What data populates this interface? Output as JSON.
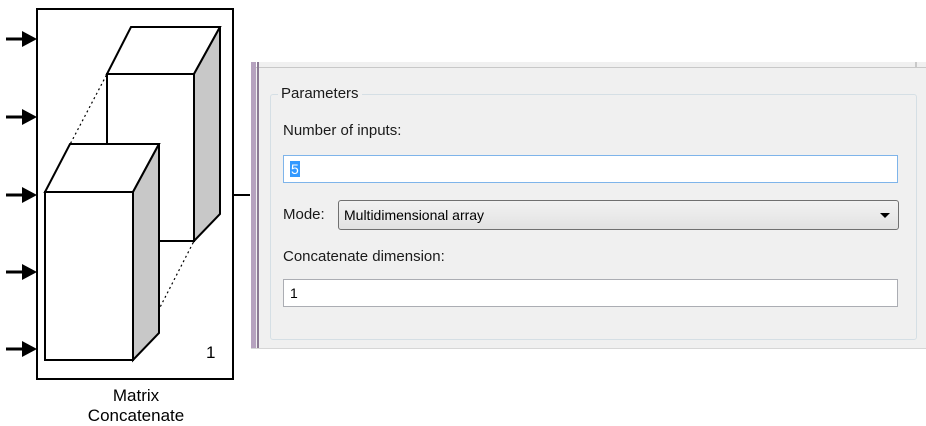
{
  "block": {
    "name_line1": "Matrix",
    "name_line2": "Concatenate",
    "output_port_number": "1",
    "input_port_count": 5
  },
  "dialog": {
    "group_title": "Parameters",
    "fields": {
      "number_of_inputs": {
        "label": "Number of inputs:",
        "value": "5"
      },
      "mode": {
        "label": "Mode:",
        "value": "Multidimensional array"
      },
      "concatenate_dimension": {
        "label": "Concatenate dimension:",
        "value": "1"
      }
    }
  },
  "icons": {
    "input_port": "input-arrow-icon",
    "output_port": "output-line-icon",
    "dropdown": "chevron-down-icon"
  },
  "colors": {
    "dialog_background": "#f0f0f0",
    "selection_highlight": "#3399ff",
    "focus_border": "#7eb4ea",
    "dialog_edge": "#b6a2bf",
    "cube_side_shade": "#c8c8c8"
  }
}
